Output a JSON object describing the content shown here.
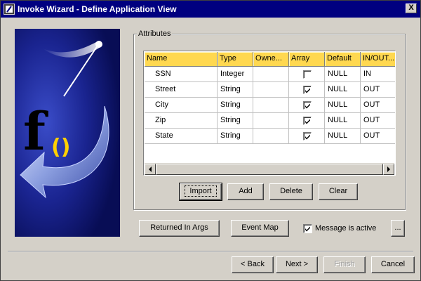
{
  "window": {
    "title": "Invoke Wizard - Define Application View",
    "close_label": "X"
  },
  "attributes": {
    "group_label": "Attributes",
    "columns": [
      "Name",
      "Type",
      "Owne...",
      "Array",
      "Default",
      "IN/OUT..."
    ],
    "rows": [
      {
        "name": "SSN",
        "type": "Integer",
        "owner": "",
        "array": false,
        "default": "NULL",
        "inout": "IN"
      },
      {
        "name": "Street",
        "type": "String",
        "owner": "",
        "array": true,
        "default": "NULL",
        "inout": "OUT"
      },
      {
        "name": "City",
        "type": "String",
        "owner": "",
        "array": true,
        "default": "NULL",
        "inout": "OUT"
      },
      {
        "name": "Zip",
        "type": "String",
        "owner": "",
        "array": true,
        "default": "NULL",
        "inout": "OUT"
      },
      {
        "name": "State",
        "type": "String",
        "owner": "",
        "array": true,
        "default": "NULL",
        "inout": "OUT"
      }
    ],
    "buttons": {
      "import": "Import",
      "add": "Add",
      "delete": "Delete",
      "clear": "Clear"
    }
  },
  "options": {
    "returned_in_args": "Returned In Args",
    "event_map": "Event Map",
    "message_active_label": "Message is active",
    "message_active_checked": true,
    "more": "..."
  },
  "nav": {
    "back": "< Back",
    "next": "Next >",
    "finish": "Finish",
    "cancel": "Cancel"
  },
  "colors": {
    "titlebar": "#000080",
    "header": "#ffd850",
    "banner": "#0a1166"
  }
}
